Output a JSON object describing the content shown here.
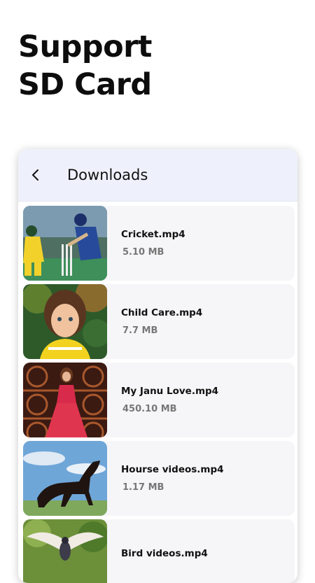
{
  "headline": {
    "line1": "Support",
    "line2": "SD Card"
  },
  "app_bar": {
    "title": "Downloads",
    "back_icon": "chevron-left-icon"
  },
  "files": [
    {
      "name": "Cricket.mp4",
      "size": "5.10 MB",
      "thumbnail": "cricket-thumbnail"
    },
    {
      "name": "Child Care.mp4",
      "size": "7.7 MB",
      "thumbnail": "child-portrait-thumbnail"
    },
    {
      "name": "My Janu Love.mp4",
      "size": "450.10 MB",
      "thumbnail": "woman-red-dress-thumbnail"
    },
    {
      "name": "Hourse videos.mp4",
      "size": "1.17 MB",
      "thumbnail": "horse-thumbnail"
    },
    {
      "name": "Bird videos.mp4",
      "size": "",
      "thumbnail": "bird-thumbnail"
    }
  ]
}
